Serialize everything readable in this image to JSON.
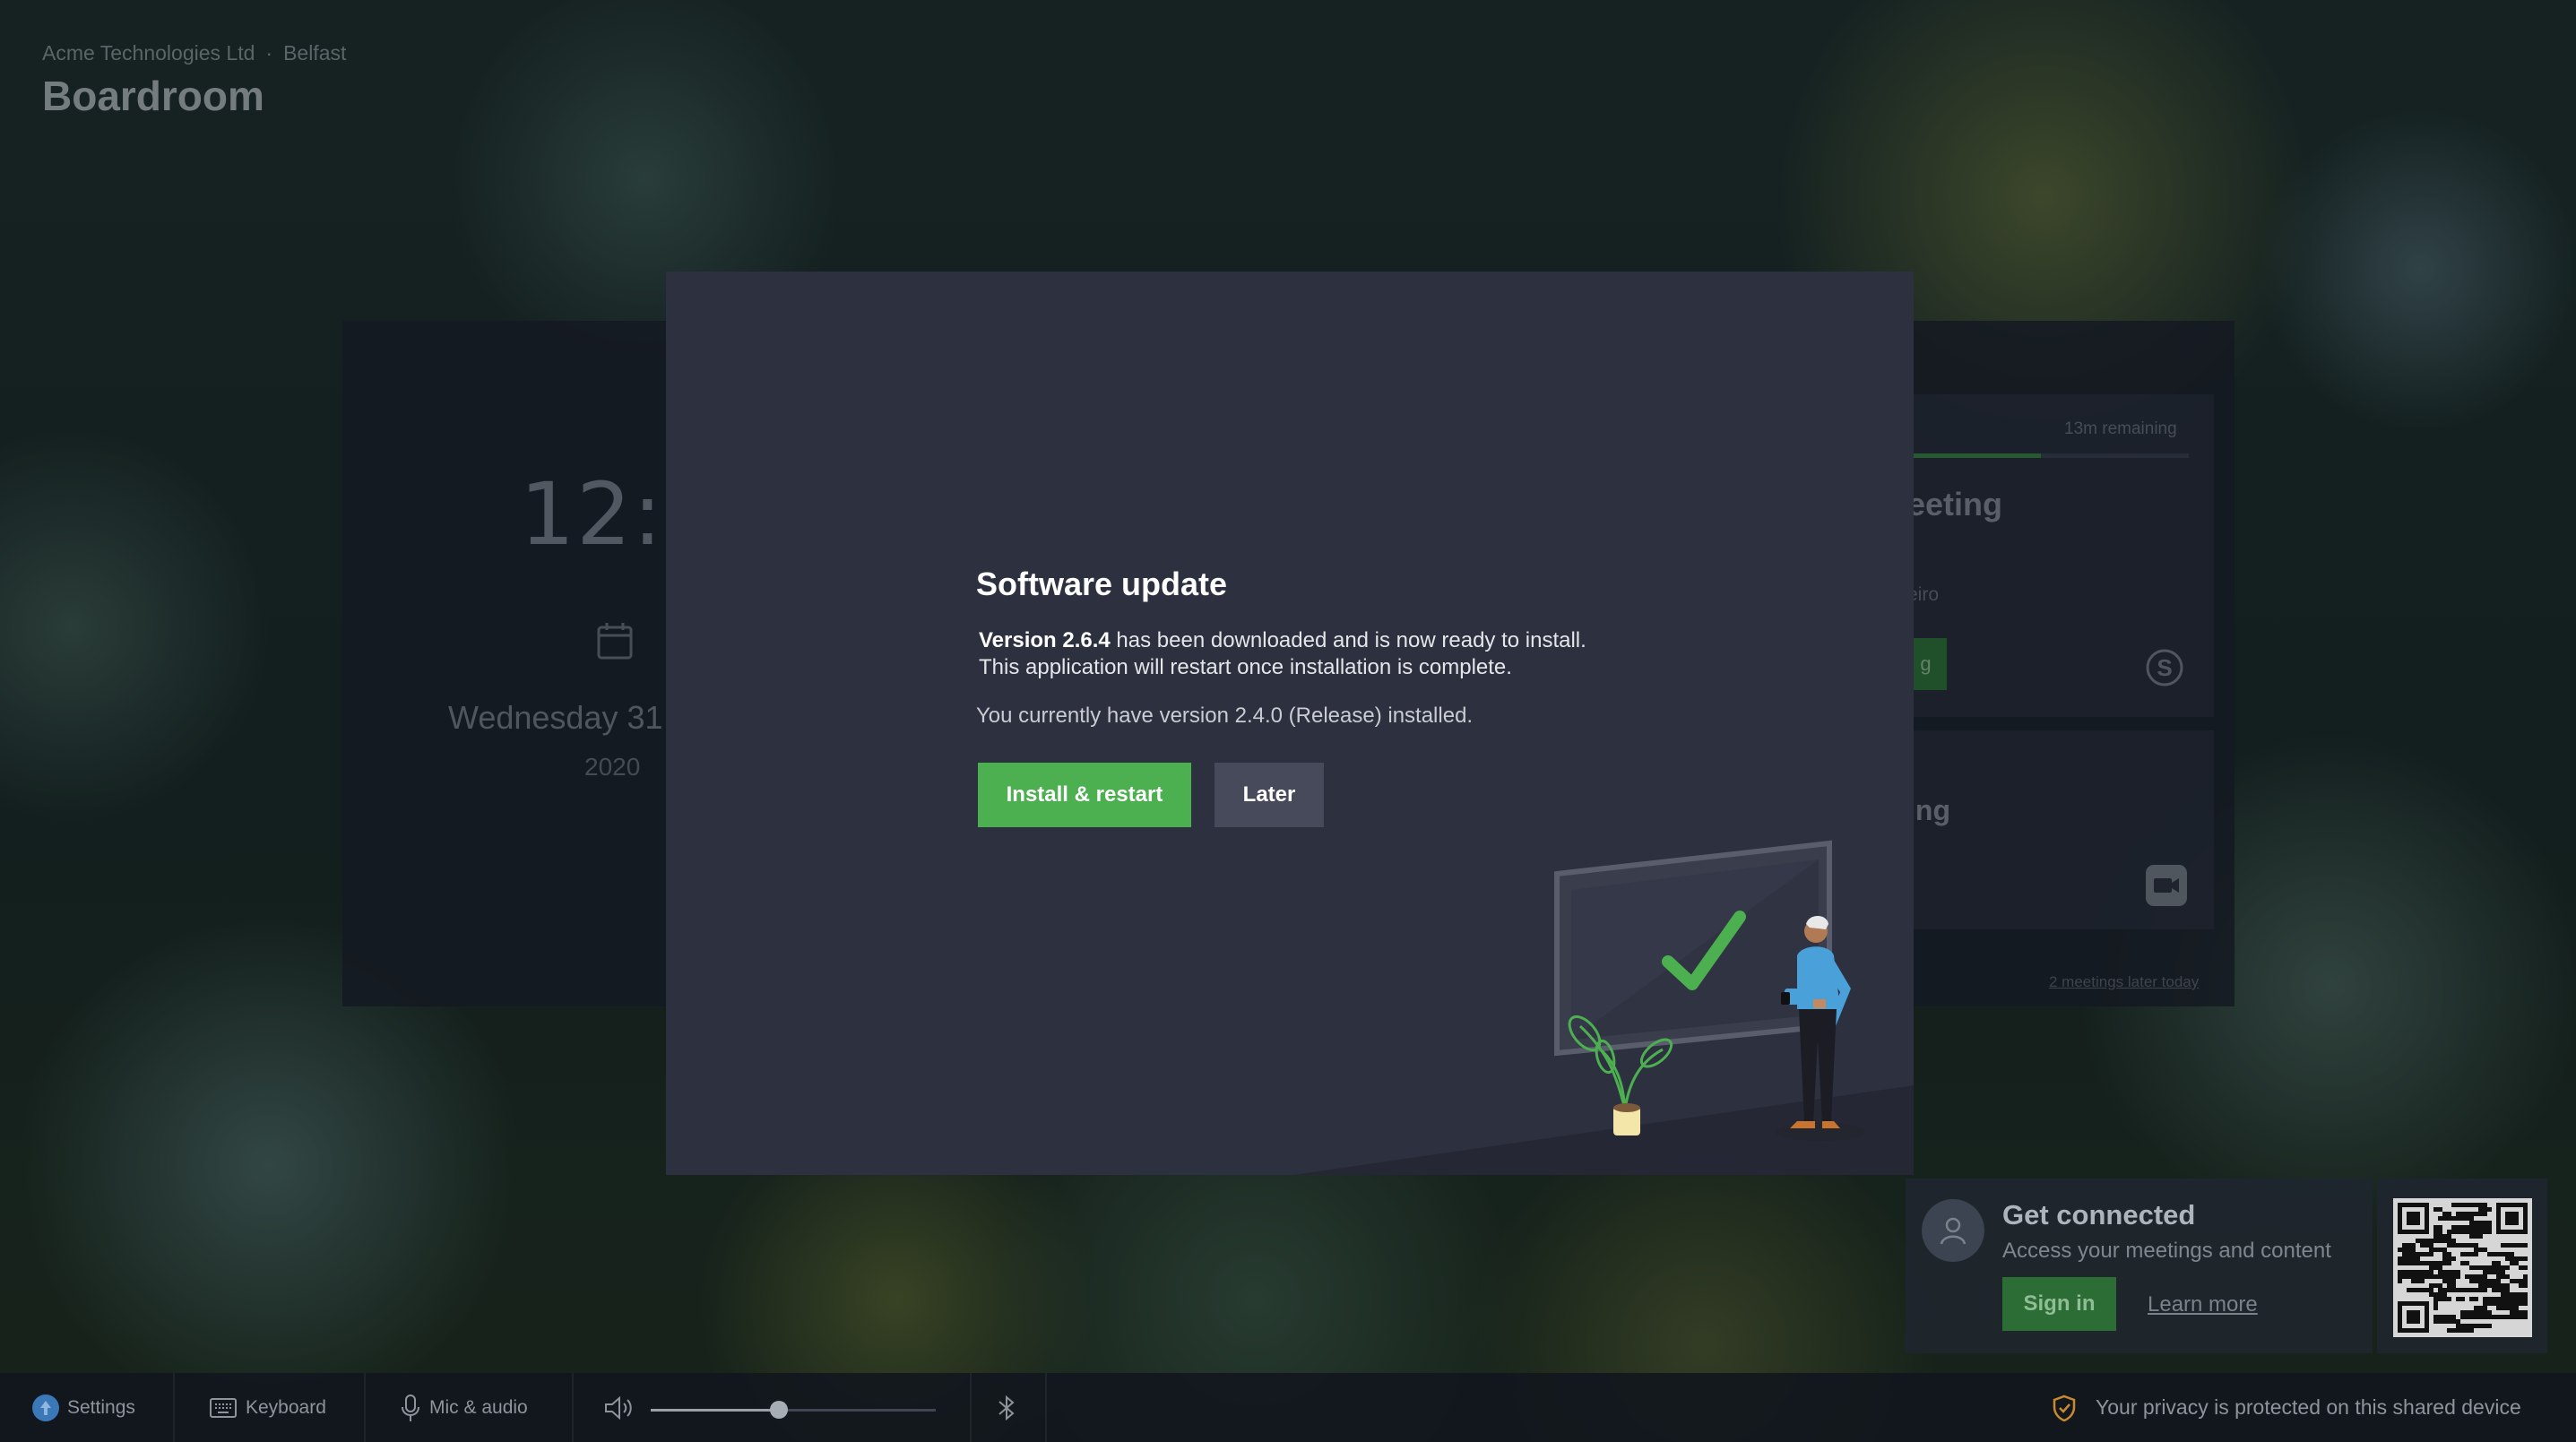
{
  "header": {
    "org": "Acme Technologies Ltd",
    "location": "Belfast",
    "room": "Boardroom"
  },
  "clock_panel": {
    "time": "12:4",
    "day": "Wednesday 31",
    "year": "2020"
  },
  "meetings_panel": {
    "remaining": "13m remaining",
    "remaining_fraction": 0.47,
    "current_title_partial": "eeting",
    "current_org_partial": "eiro",
    "current_button_partial": "g",
    "next_title_partial": "ing",
    "later_link": "2 meetings later today"
  },
  "dialog": {
    "title": "Software update",
    "version": "Version 2.6.4",
    "line1_rest": " has been downloaded and is now ready to install.",
    "line2": "This application will restart once installation is complete.",
    "line3": "You currently have version 2.4.0 (Release) installed.",
    "install_label": "Install & restart",
    "later_label": "Later"
  },
  "get_connected": {
    "title": "Get connected",
    "subtitle": "Access your meetings and content",
    "sign_in": "Sign in",
    "learn_more": "Learn more"
  },
  "taskbar": {
    "settings": "Settings",
    "keyboard": "Keyboard",
    "mic_audio": "Mic & audio",
    "volume_fraction": 0.45,
    "privacy": "Your privacy is protected on this shared device"
  },
  "colors": {
    "accent_green": "#4caf50",
    "dialog_bg": "#2d303e",
    "later_bg": "#474a5a"
  },
  "icons": [
    "calendar-icon",
    "skype-icon",
    "camera-icon",
    "person-icon",
    "qr-code",
    "settings-icon",
    "keyboard-icon",
    "mic-icon",
    "speaker-icon",
    "bluetooth-icon",
    "shield-icon"
  ]
}
